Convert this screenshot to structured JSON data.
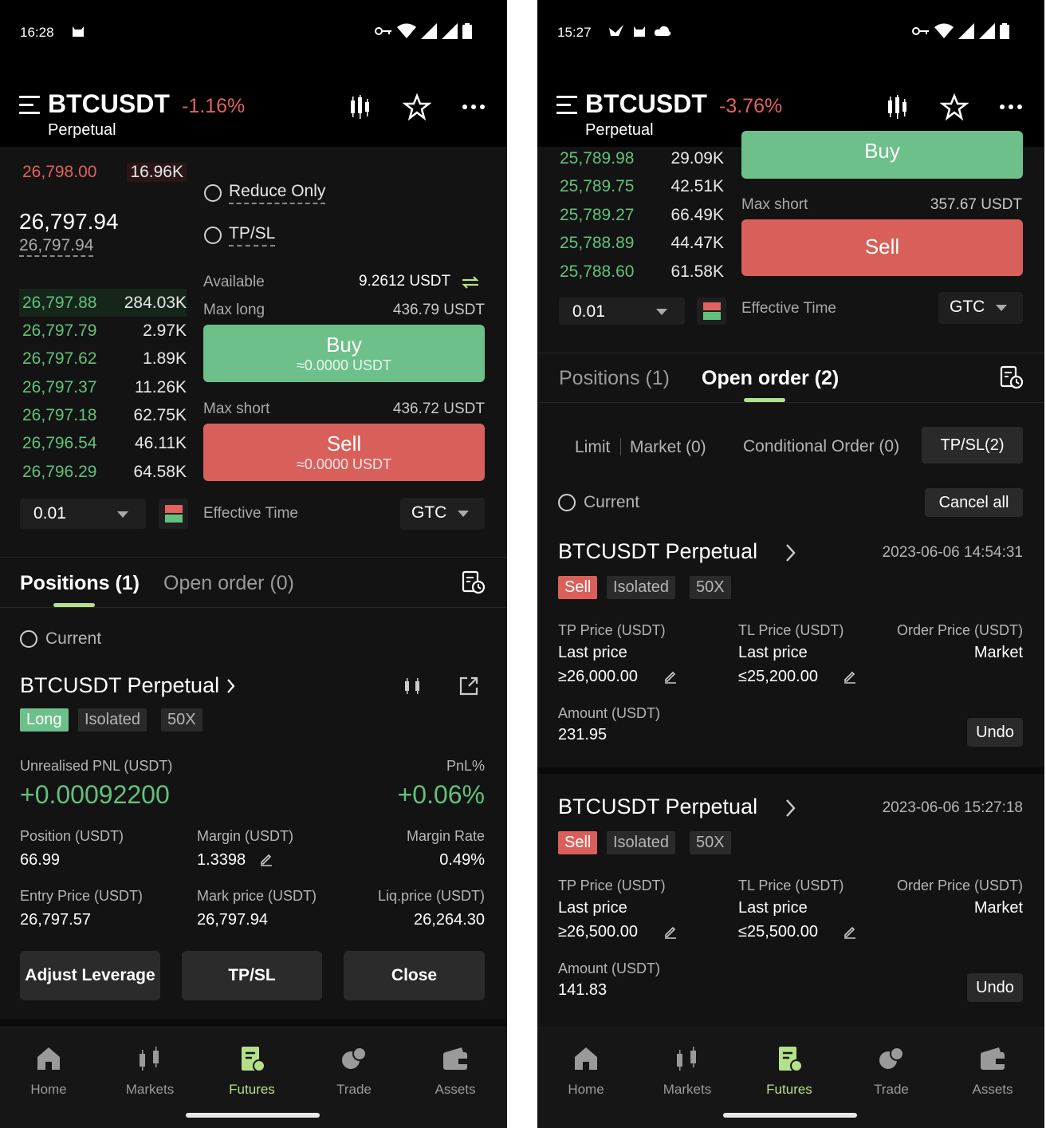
{
  "nav_labels": [
    "Home",
    "Markets",
    "Futures",
    "Trade",
    "Assets"
  ],
  "left": {
    "status_time": "16:28",
    "symbol": "BTCUSDT",
    "change": "-1.16%",
    "perpetual": "Perpetual",
    "asks": [
      {
        "price": "26,798.00",
        "qty": "16.96K"
      }
    ],
    "mid_price": "26,797.94",
    "mark_price": "26,797.94",
    "bids": [
      {
        "price": "26,797.88",
        "qty": "284.03K"
      },
      {
        "price": "26,797.79",
        "qty": "2.97K"
      },
      {
        "price": "26,797.62",
        "qty": "1.89K"
      },
      {
        "price": "26,797.37",
        "qty": "11.26K"
      },
      {
        "price": "26,797.18",
        "qty": "62.75K"
      },
      {
        "price": "26,796.54",
        "qty": "46.11K"
      },
      {
        "price": "26,796.29",
        "qty": "64.58K"
      }
    ],
    "reduce_only": "Reduce Only",
    "tpsl_option": "TP/SL",
    "available_label": "Available",
    "available_value": "9.2612 USDT",
    "max_long_label": "Max long",
    "max_long_value": "436.79 USDT",
    "buy_label": "Buy",
    "buy_sub": "≈0.0000 USDT",
    "max_short_label": "Max short",
    "max_short_value": "436.72 USDT",
    "sell_label": "Sell",
    "sell_sub": "≈0.0000 USDT",
    "precision": "0.01",
    "effective_time_label": "Effective Time",
    "effective_time_value": "GTC",
    "tab_positions": "Positions (1)",
    "tab_open_order": "Open order (0)",
    "current_label": "Current",
    "position": {
      "title": "BTCUSDT Perpetual",
      "side": "Long",
      "margin_mode": "Isolated",
      "leverage": "50X",
      "upnl_label": "Unrealised PNL (USDT)",
      "upnl_value": "+0.00092200",
      "pnl_pct_label": "PnL%",
      "pnl_pct_value": "+0.06%",
      "position_label": "Position (USDT)",
      "position_value": "66.99",
      "margin_label": "Margin (USDT)",
      "margin_value": "1.3398",
      "margin_rate_label": "Margin Rate",
      "margin_rate_value": "0.49%",
      "entry_label": "Entry Price (USDT)",
      "entry_value": "26,797.57",
      "mark_label": "Mark price (USDT)",
      "mark_value": "26,797.94",
      "liq_label": "Liq.price (USDT)",
      "liq_value": "26,264.30",
      "btn_adjust": "Adjust Leverage",
      "btn_tpsl": "TP/SL",
      "btn_close": "Close"
    }
  },
  "right": {
    "status_time": "15:27",
    "symbol": "BTCUSDT",
    "change": "-3.76%",
    "perpetual": "Perpetual",
    "bids": [
      {
        "price": "25,789.98",
        "qty": "29.09K"
      },
      {
        "price": "25,789.75",
        "qty": "42.51K"
      },
      {
        "price": "25,789.27",
        "qty": "66.49K"
      },
      {
        "price": "25,788.89",
        "qty": "44.47K"
      },
      {
        "price": "25,788.60",
        "qty": "61.58K"
      }
    ],
    "buy_label": "Buy",
    "max_short_label": "Max short",
    "max_short_value": "357.67 USDT",
    "sell_label": "Sell",
    "precision": "0.01",
    "effective_time_label": "Effective Time",
    "effective_time_value": "GTC",
    "tab_positions": "Positions (1)",
    "tab_open_order": "Open order (2)",
    "subtab_limit": "Limit",
    "subtab_market": "Market (0)",
    "subtab_conditional": "Conditional Order (0)",
    "subtab_tpsl": "TP/SL(2)",
    "current_label": "Current",
    "cancel_all": "Cancel all",
    "orders": [
      {
        "title": "BTCUSDT Perpetual",
        "time": "2023-06-06 14:54:31",
        "side": "Sell",
        "margin_mode": "Isolated",
        "leverage": "50X",
        "tp_label": "TP Price (USDT)",
        "tp_trigger": "Last price",
        "tp_value": "≥26,000.00",
        "tl_label": "TL Price (USDT)",
        "tl_trigger": "Last price",
        "tl_value": "≤25,200.00",
        "order_price_label": "Order Price (USDT)",
        "order_price_value": "Market",
        "amount_label": "Amount (USDT)",
        "amount_value": "231.95",
        "undo": "Undo"
      },
      {
        "title": "BTCUSDT Perpetual",
        "time": "2023-06-06 15:27:18",
        "side": "Sell",
        "margin_mode": "Isolated",
        "leverage": "50X",
        "tp_label": "TP Price (USDT)",
        "tp_trigger": "Last price",
        "tp_value": "≥26,500.00",
        "tl_label": "TL Price (USDT)",
        "tl_trigger": "Last price",
        "tl_value": "≤25,500.00",
        "order_price_label": "Order Price (USDT)",
        "order_price_value": "Market",
        "amount_label": "Amount (USDT)",
        "amount_value": "141.83",
        "undo": "Undo"
      }
    ]
  },
  "colors": {
    "background": "#131313",
    "up_green": "#62c17c",
    "down_red": "#e1625e",
    "buy_button": "#6dc089",
    "sell_button": "#d9605a",
    "accent_lime": "#b4e08a"
  },
  "icons": [
    "menu-icon",
    "candlestick-icon",
    "star-icon",
    "more-icon",
    "order-history-icon",
    "share-icon",
    "swap-icon",
    "pencil-icon",
    "home-icon",
    "markets-icon",
    "futures-icon",
    "trade-icon",
    "assets-icon"
  ]
}
